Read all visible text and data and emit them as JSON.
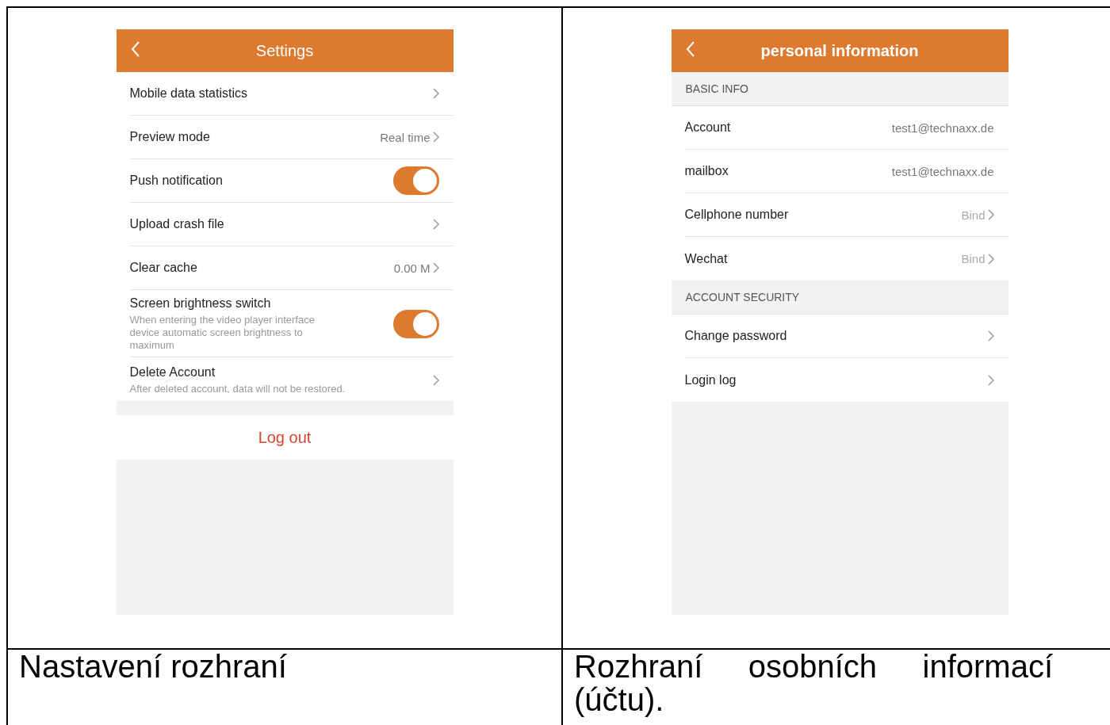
{
  "cells": [
    {
      "screen": {
        "title": "Settings",
        "title_bold": false,
        "sections": [
          {
            "rows": [
              {
                "kind": "link",
                "label": "Mobile data statistics"
              },
              {
                "kind": "link",
                "label": "Preview mode",
                "value": "Real time"
              },
              {
                "kind": "toggle",
                "label": "Push notification",
                "on": true
              },
              {
                "kind": "link",
                "label": "Upload crash file"
              },
              {
                "kind": "link",
                "label": "Clear cache",
                "value": "0.00 M"
              },
              {
                "kind": "toggle",
                "label": "Screen brightness switch",
                "description": "When entering the video player interface device automatic screen brightness to maximum",
                "on": true
              },
              {
                "kind": "link",
                "label": "Delete Account",
                "description": "After deleted account, data will not be restored."
              }
            ]
          }
        ],
        "logout": "Log out"
      },
      "caption": "Nastavení rozhraní"
    },
    {
      "screen": {
        "title": "personal information",
        "title_bold": true,
        "sections": [
          {
            "header": "BASIC INFO",
            "rows": [
              {
                "kind": "value",
                "label": "Account",
                "value": "test1@technaxx.de"
              },
              {
                "kind": "value",
                "label": "mailbox",
                "value": "test1@technaxx.de"
              },
              {
                "kind": "link",
                "label": "Cellphone number",
                "value": "Bind",
                "muted": true
              },
              {
                "kind": "link",
                "label": "Wechat",
                "value": "Bind",
                "muted": true
              }
            ]
          },
          {
            "header": "ACCOUNT SECURITY",
            "rows": [
              {
                "kind": "link",
                "label": "Change password"
              },
              {
                "kind": "link",
                "label": "Login log"
              }
            ]
          }
        ]
      },
      "caption": "Rozhraní osobních informací (účtu)."
    }
  ]
}
